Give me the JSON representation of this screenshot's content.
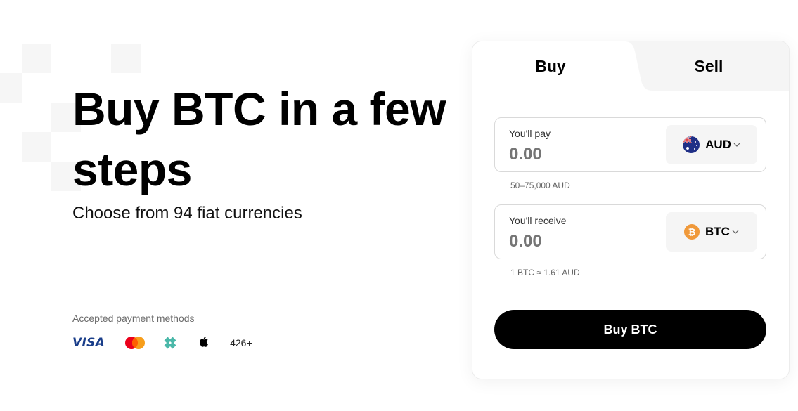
{
  "hero": {
    "title": "Buy BTC in a few steps",
    "subtitle": "Choose from 94 fiat currencies"
  },
  "payment_methods": {
    "label": "Accepted payment methods",
    "visa_text": "VISA",
    "icons": [
      "visa-logo",
      "mastercard-logo",
      "pix-logo",
      "apple-pay-logo"
    ],
    "more": "426+"
  },
  "widget": {
    "tabs": [
      {
        "label": "Buy",
        "active": true
      },
      {
        "label": "Sell",
        "active": false
      }
    ],
    "pay": {
      "label": "You'll pay",
      "value": "0.00",
      "currency": "AUD",
      "currency_icon": "australia-flag-icon",
      "hint": "50–75,000 AUD"
    },
    "receive": {
      "label": "You'll receive",
      "value": "0.00",
      "currency": "BTC",
      "currency_icon": "bitcoin-icon",
      "hint": "1 BTC ≈ 1.61 AUD"
    },
    "cta": "Buy BTC"
  },
  "colors": {
    "accent": "#000000",
    "bitcoin": "#f0993a",
    "visa": "#1a3e8a"
  }
}
